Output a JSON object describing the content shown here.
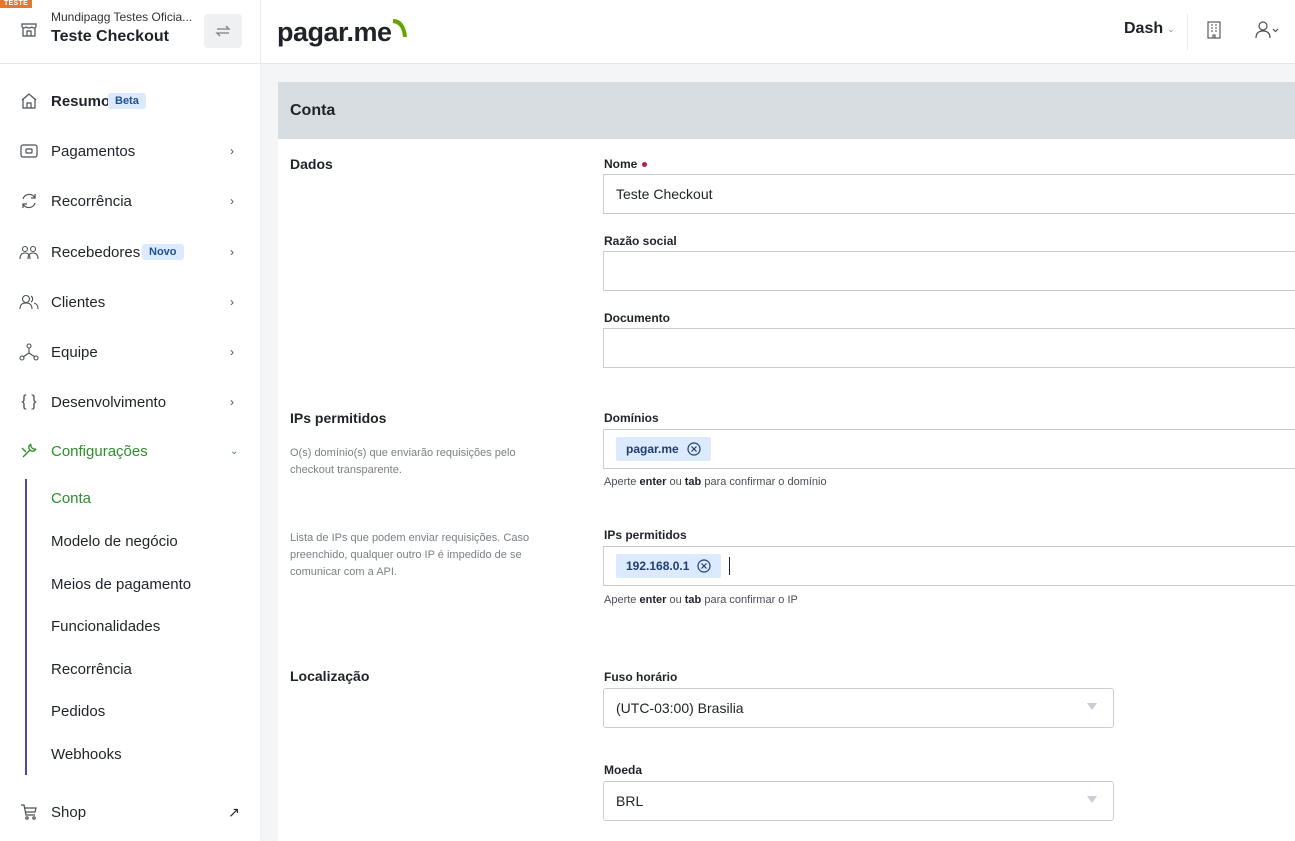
{
  "header": {
    "env_tag": "TESTE",
    "org_name": "Mundipagg Testes Oficia...",
    "account_name": "Teste Checkout",
    "logo_text_1": "pagar.",
    "logo_text_2": "me",
    "menu_label": "Dash",
    "brand_color": "#2c8f2a"
  },
  "sidebar": {
    "items": [
      {
        "label": "Resumo",
        "badge": "Beta"
      },
      {
        "label": "Pagamentos"
      },
      {
        "label": "Recorrência"
      },
      {
        "label": "Recebedores",
        "badge": "Novo"
      },
      {
        "label": "Clientes"
      },
      {
        "label": "Equipe"
      },
      {
        "label": "Desenvolvimento"
      },
      {
        "label": "Configurações"
      }
    ],
    "sub_items": [
      "Conta",
      "Modelo de negócio",
      "Meios de pagamento",
      "Funcionalidades",
      "Recorrência",
      "Pedidos",
      "Webhooks"
    ],
    "shop_label": "Shop"
  },
  "main": {
    "title": "Conta",
    "sections": {
      "dados": "Dados",
      "ips": "IPs permitidos",
      "ips_desc_domains": "O(s) domínio(s) que enviarão requisições pelo checkout transparente.",
      "ips_desc_ips": "Lista de IPs que podem enviar requisições. Caso preenchido, qualquer outro IP é impedido de se comunicar com a API.",
      "localizacao": "Localização"
    },
    "fields": {
      "nome_label": "Nome",
      "nome_value": "Teste Checkout",
      "razao_label": "Razão social",
      "razao_value": "",
      "documento_label": "Documento",
      "documento_value": "",
      "dominios_label": "Domínios",
      "dominio_chip": "pagar.me",
      "dominios_hint_pre": "Aperte",
      "dominios_hint_enter": "enter",
      "dominios_hint_ou": "ou",
      "dominios_hint_tab": "tab",
      "dominios_hint_post": "para confirmar o domínio",
      "ips_label": "IPs permitidos",
      "ip_chip": "192.168.0.1",
      "ips_hint_pre": "Aperte",
      "ips_hint_enter": "enter",
      "ips_hint_ou": "ou",
      "ips_hint_tab": "tab",
      "ips_hint_post": "para confirmar o IP",
      "fuso_label": "Fuso horário",
      "fuso_value": "(UTC-03:00) Brasilia",
      "moeda_label": "Moeda",
      "moeda_value": "BRL"
    }
  }
}
